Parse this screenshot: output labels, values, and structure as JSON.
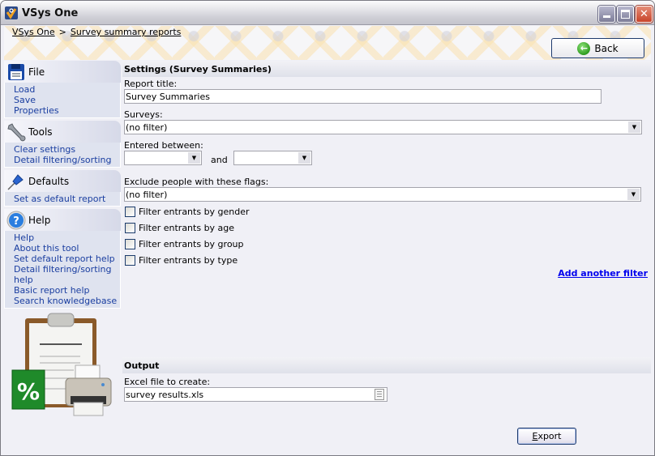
{
  "window": {
    "title": "VSys One",
    "controls": {
      "minimize": "_",
      "maximize": "□",
      "close": "✕"
    }
  },
  "breadcrumb": {
    "items": [
      "VSys One",
      "Survey summary reports"
    ],
    "separator": ">"
  },
  "back_button": {
    "label": "Back",
    "icon": "back-arrow-icon"
  },
  "sidebar": {
    "groups": [
      {
        "title": "File",
        "icon": "floppy-disk-icon",
        "items": [
          "Load",
          "Save",
          "Properties"
        ]
      },
      {
        "title": "Tools",
        "icon": "wrench-icon",
        "items": [
          "Clear settings",
          "Detail filtering/sorting"
        ]
      },
      {
        "title": "Defaults",
        "icon": "pushpin-icon",
        "items": [
          "Set as default report"
        ]
      },
      {
        "title": "Help",
        "icon": "help-icon",
        "items": [
          "Help",
          "About this tool",
          "Set default report help",
          "Detail filtering/sorting help",
          "Basic report help",
          "Search knowledgebase"
        ]
      }
    ]
  },
  "settings": {
    "heading": "Settings (Survey Summaries)",
    "report_title_label": "Report title:",
    "report_title_value": "Survey Summaries",
    "surveys_label": "Surveys:",
    "surveys_value": "(no filter)",
    "entered_between_label": "Entered between:",
    "date_from_value": "",
    "and_label": "and",
    "date_to_value": "",
    "exclude_flags_label": "Exclude people with these flags:",
    "exclude_flags_value": "(no filter)",
    "filters": [
      {
        "label": "Filter entrants by gender",
        "checked": false
      },
      {
        "label": "Filter entrants by age",
        "checked": false
      },
      {
        "label": "Filter entrants by group",
        "checked": false
      },
      {
        "label": "Filter entrants by type",
        "checked": false
      }
    ],
    "add_filter_link": "Add another filter"
  },
  "output": {
    "heading": "Output",
    "excel_file_label": "Excel file to create:",
    "excel_file_value": "survey results.xls",
    "export_button": "Export"
  }
}
